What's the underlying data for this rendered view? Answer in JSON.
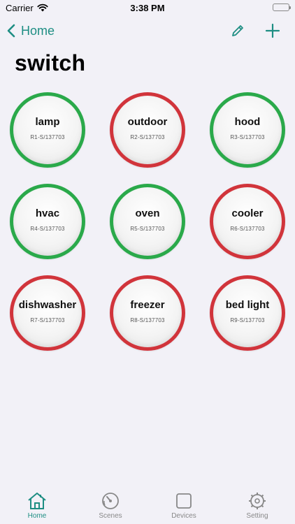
{
  "status_bar": {
    "carrier": "Carrier",
    "time": "3:38 PM"
  },
  "nav": {
    "back_label": "Home"
  },
  "page_title": "switch",
  "colors": {
    "accent": "#1e8e83",
    "on": "#2aa94a",
    "off": "#d1343b"
  },
  "switches": [
    {
      "name": "lamp",
      "id": "R1-S/137703",
      "state": "on"
    },
    {
      "name": "outdoor",
      "id": "R2-S/137703",
      "state": "off"
    },
    {
      "name": "hood",
      "id": "R3-S/137703",
      "state": "on"
    },
    {
      "name": "hvac",
      "id": "R4-S/137703",
      "state": "on"
    },
    {
      "name": "oven",
      "id": "R5-S/137703",
      "state": "on"
    },
    {
      "name": "cooler",
      "id": "R6-S/137703",
      "state": "off"
    },
    {
      "name": "dishwasher",
      "id": "R7-S/137703",
      "state": "off"
    },
    {
      "name": "freezer",
      "id": "R8-S/137703",
      "state": "off"
    },
    {
      "name": "bed light",
      "id": "R9-S/137703",
      "state": "off"
    }
  ],
  "tabs": [
    {
      "label": "Home",
      "icon": "home-icon",
      "active": true
    },
    {
      "label": "Scenes",
      "icon": "gauge-icon",
      "active": false
    },
    {
      "label": "Devices",
      "icon": "square-icon",
      "active": false
    },
    {
      "label": "Setting",
      "icon": "settings-icon",
      "active": false
    }
  ]
}
